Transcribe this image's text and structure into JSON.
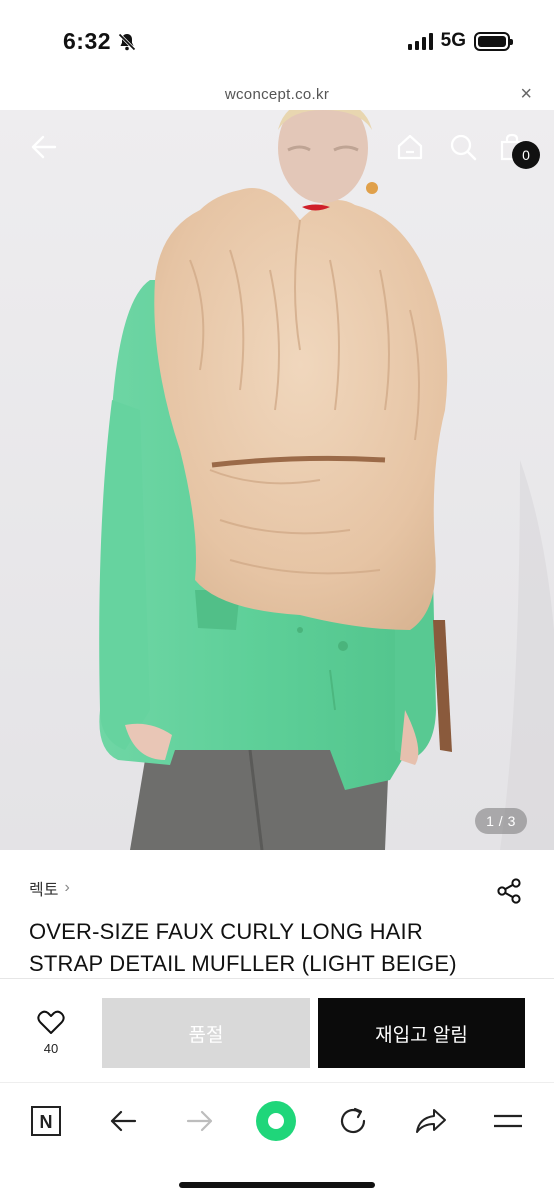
{
  "status_bar": {
    "time": "6:32",
    "network": "5G",
    "icons": [
      "bell-slash-icon",
      "signal-icon",
      "battery-icon"
    ]
  },
  "browser": {
    "url": "wconcept.co.kr",
    "close_glyph": "×"
  },
  "hero": {
    "cart_count": "0",
    "pager": "1 / 3",
    "icons": [
      "back-arrow-icon",
      "home-icon",
      "search-icon",
      "shopping-bag-icon"
    ]
  },
  "product": {
    "brand": "렉토",
    "brand_chevron": "›",
    "title_line1": "OVER-SIZE FAUX CURLY LONG HAIR",
    "title_line2": "STRAP DETAIL MUFLLER (LIGHT BEIGE)"
  },
  "actions": {
    "like_count": "40",
    "soldout_label": "품절",
    "restock_label": "재입고 알림"
  },
  "toolbar": {
    "n_label": "N",
    "icons": [
      "n-icon",
      "back-arrow-icon",
      "forward-arrow-icon",
      "green-circle-icon",
      "reload-icon",
      "share-arrow-icon",
      "menu-icon"
    ]
  },
  "colors": {
    "accent_green": "#1fd67a",
    "coat_green": "#5fd29b",
    "fur_beige": "#e8c9ac",
    "soldout_gray": "#d9d9d9",
    "black": "#0b0b0b"
  }
}
